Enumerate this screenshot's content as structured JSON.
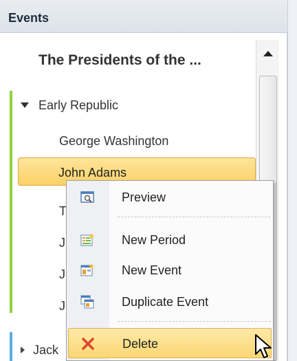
{
  "pane": {
    "header": "Events",
    "timeline_title": "The Presidents of the ..."
  },
  "tree": {
    "group1": {
      "label": "Early Republic",
      "expanded": true,
      "color": "#8fd13f"
    },
    "group1_events": [
      {
        "label": "George Washington"
      },
      {
        "label": "John Adams",
        "selected": true
      },
      {
        "label": "T"
      },
      {
        "label": "J"
      },
      {
        "label": "J"
      },
      {
        "label": "J"
      }
    ],
    "group2": {
      "label": "Jack",
      "expanded": false,
      "color": "#58aee0"
    }
  },
  "context_menu": {
    "items": [
      {
        "label": "Preview",
        "icon": "preview-icon"
      },
      {
        "label": "New Period",
        "icon": "new-period-icon"
      },
      {
        "label": "New Event",
        "icon": "new-event-icon"
      },
      {
        "label": "Duplicate Event",
        "icon": "duplicate-event-icon"
      },
      {
        "label": "Delete",
        "icon": "delete-x-icon",
        "highlighted": true
      }
    ]
  },
  "colors": {
    "selection": "#fbd168",
    "delete_icon": "#e0442a"
  }
}
